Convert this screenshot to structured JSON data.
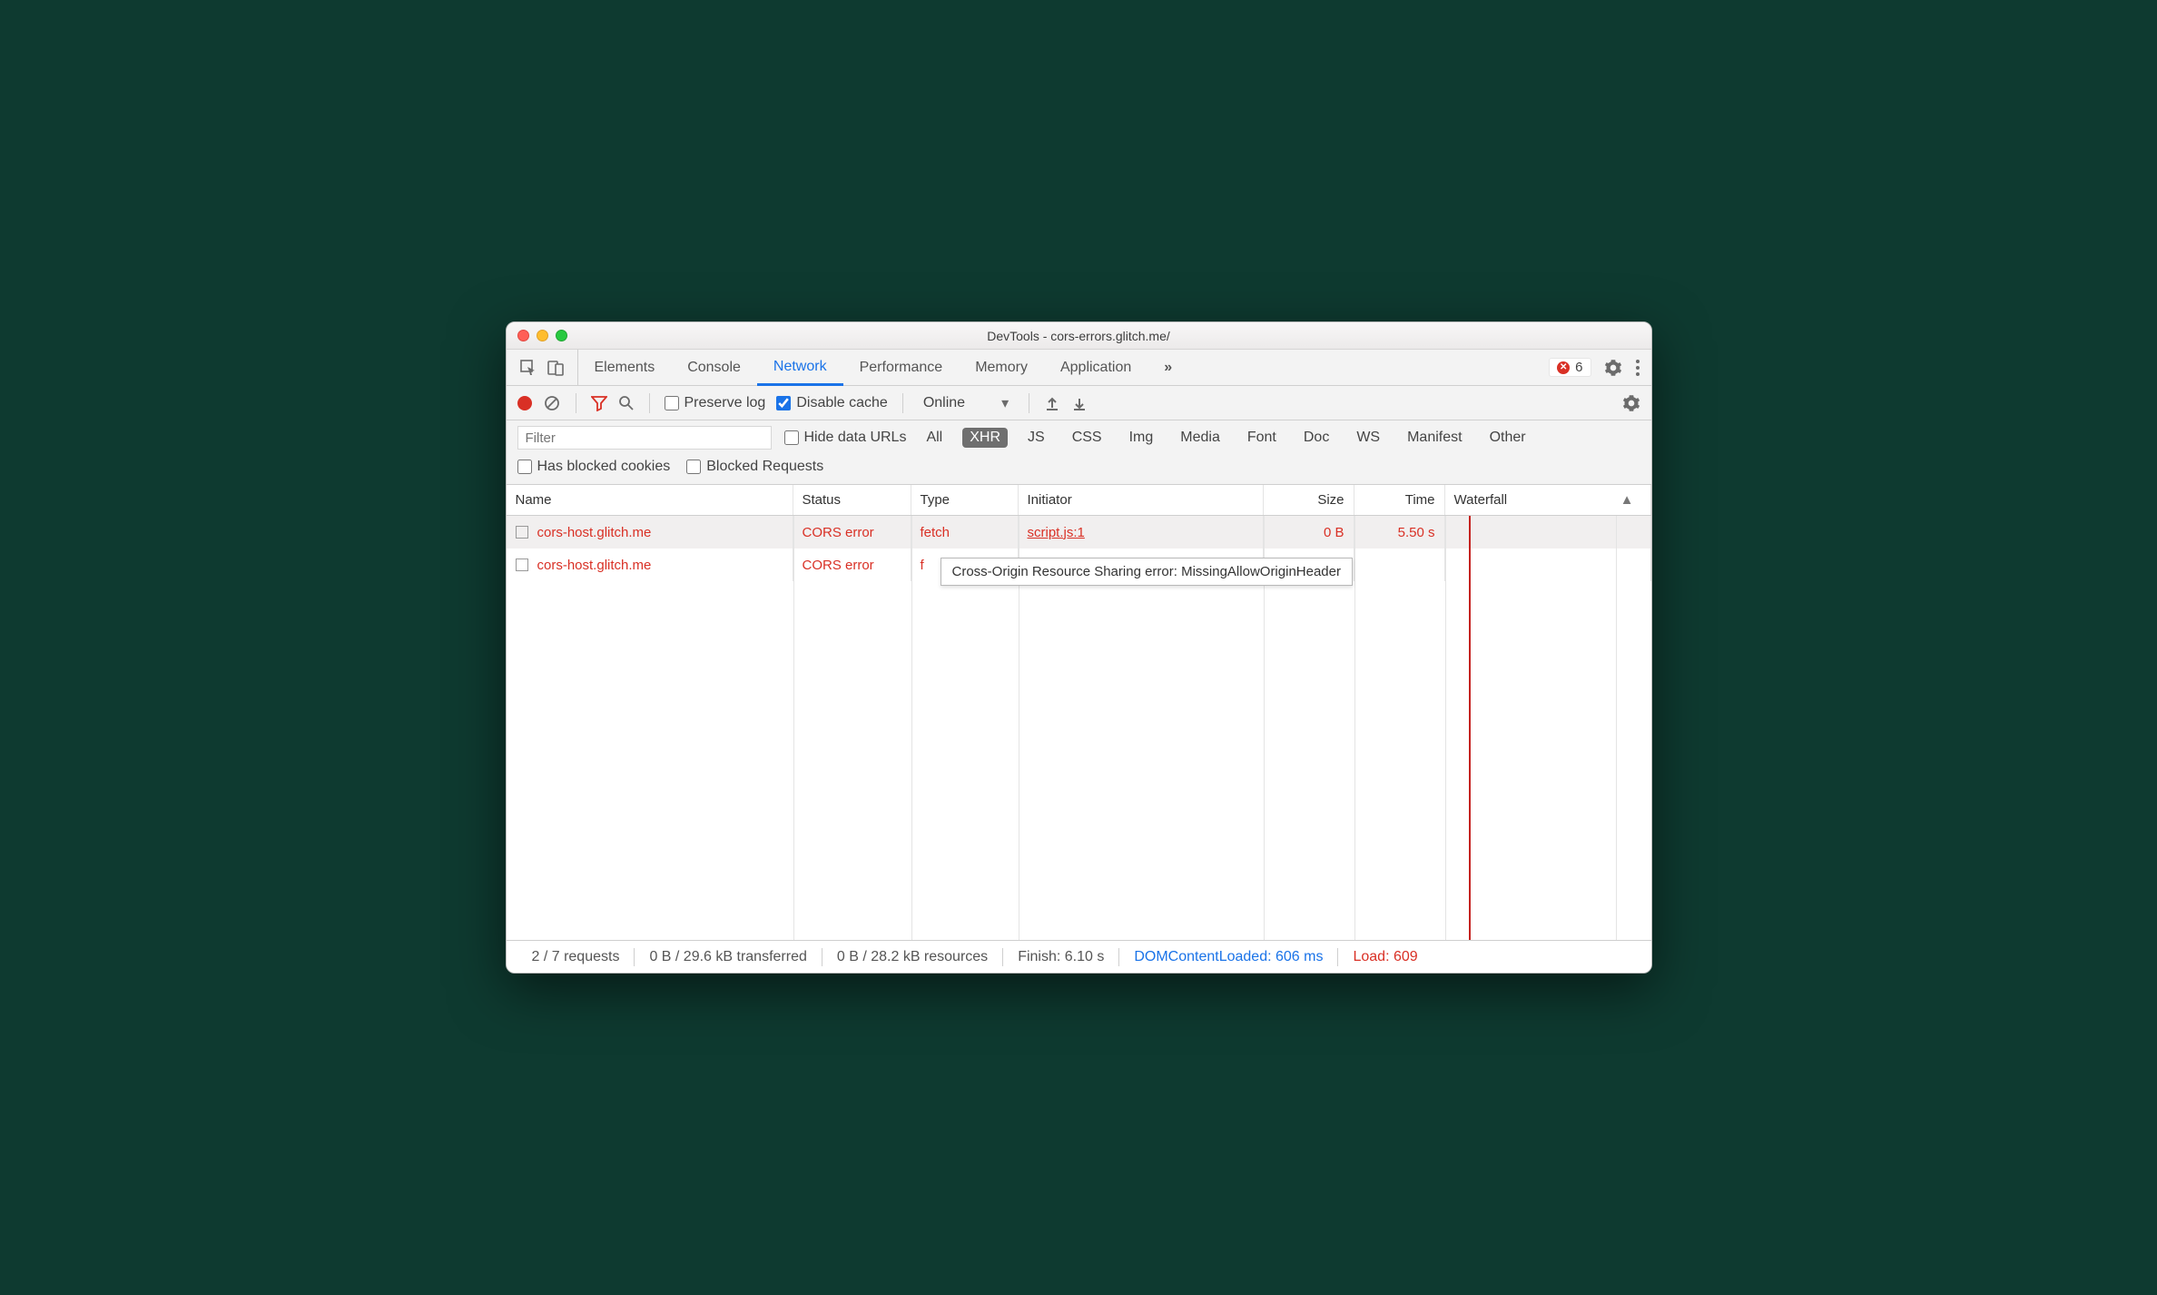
{
  "titlebar": {
    "title": "DevTools - cors-errors.glitch.me/"
  },
  "tabs": {
    "items": [
      "Elements",
      "Console",
      "Network",
      "Performance",
      "Memory",
      "Application"
    ],
    "active": "Network",
    "overflow_glyph": "»",
    "error_count": "6"
  },
  "toolbar": {
    "preserve_log": "Preserve log",
    "disable_cache": "Disable cache",
    "throttling": "Online"
  },
  "filter": {
    "placeholder": "Filter",
    "hide_data_urls": "Hide data URLs",
    "types": [
      "All",
      "XHR",
      "JS",
      "CSS",
      "Img",
      "Media",
      "Font",
      "Doc",
      "WS",
      "Manifest",
      "Other"
    ],
    "active_type": "XHR",
    "has_blocked_cookies": "Has blocked cookies",
    "blocked_requests": "Blocked Requests"
  },
  "columns": {
    "name": "Name",
    "status": "Status",
    "type": "Type",
    "initiator": "Initiator",
    "size": "Size",
    "time": "Time",
    "waterfall": "Waterfall"
  },
  "rows": [
    {
      "name": "cors-host.glitch.me",
      "status": "CORS error",
      "type": "fetch",
      "initiator": "script.js:1",
      "size": "0 B",
      "time": "5.50 s"
    },
    {
      "name": "cors-host.glitch.me",
      "status": "CORS error",
      "type": "f",
      "initiator": "",
      "size": "",
      "time": ""
    }
  ],
  "tooltip": "Cross-Origin Resource Sharing error: MissingAllowOriginHeader",
  "statusbar": {
    "requests": "2 / 7 requests",
    "transferred": "0 B / 29.6 kB transferred",
    "resources": "0 B / 28.2 kB resources",
    "finish": "Finish: 6.10 s",
    "dom": "DOMContentLoaded: 606 ms",
    "load": "Load: 609"
  }
}
